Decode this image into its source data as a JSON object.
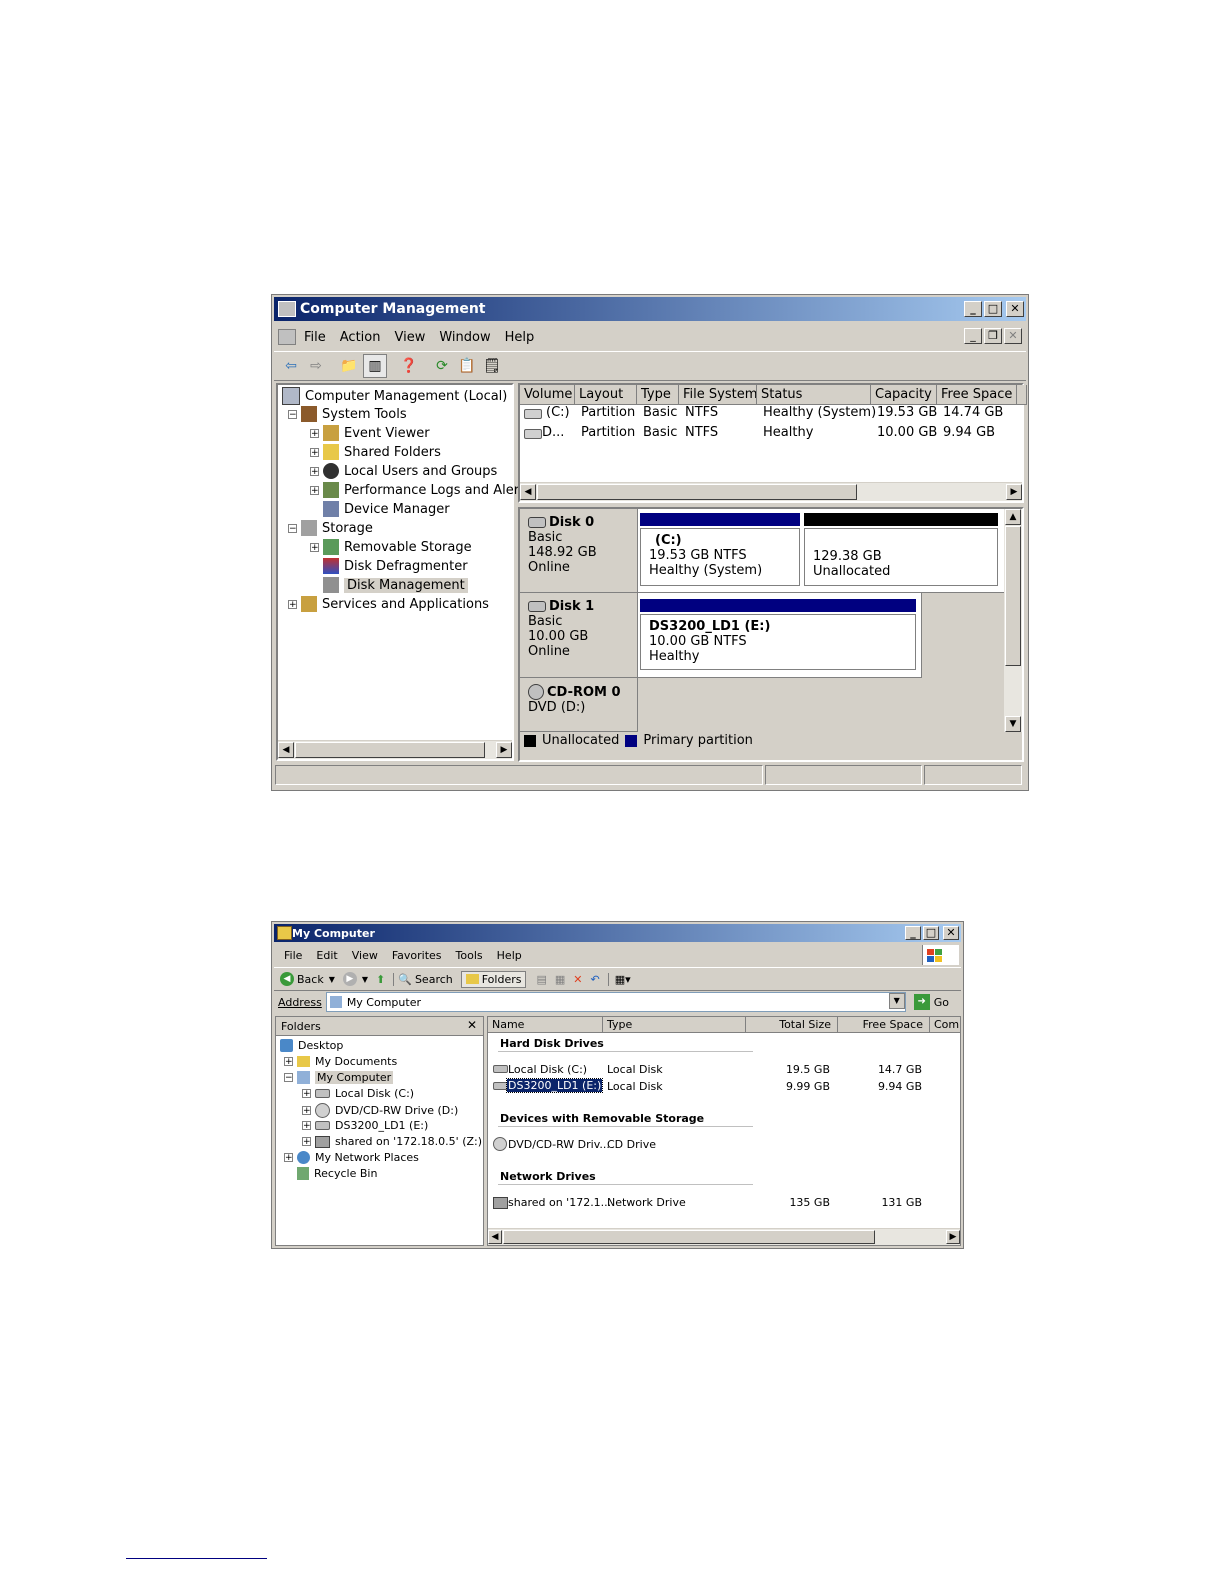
{
  "cm": {
    "title": "Computer Management",
    "menu": [
      "File",
      "Action",
      "View",
      "Window",
      "Help"
    ],
    "tree": [
      {
        "label": "Computer Management (Local)",
        "icon": "computer-icon"
      },
      {
        "label": "System Tools",
        "icon": "tools-icon"
      },
      {
        "label": "Event Viewer",
        "icon": "event-viewer-icon"
      },
      {
        "label": "Shared Folders",
        "icon": "folder-icon"
      },
      {
        "label": "Local Users and Groups",
        "icon": "users-icon"
      },
      {
        "label": "Performance Logs and Alerts",
        "icon": "performance-icon"
      },
      {
        "label": "Device Manager",
        "icon": "device-manager-icon"
      },
      {
        "label": "Storage",
        "icon": "storage-icon"
      },
      {
        "label": "Removable Storage",
        "icon": "removable-storage-icon"
      },
      {
        "label": "Disk Defragmenter",
        "icon": "defrag-icon"
      },
      {
        "label": "Disk Management",
        "icon": "disk-management-icon"
      },
      {
        "label": "Services and Applications",
        "icon": "services-icon"
      }
    ],
    "columns": [
      "Volume",
      "Layout",
      "Type",
      "File System",
      "Status",
      "Capacity",
      "Free Space"
    ],
    "rows": [
      [
        "(C:)",
        "Partition",
        "Basic",
        "NTFS",
        "Healthy (System)",
        "19.53 GB",
        "14.74 GB"
      ],
      [
        "D...",
        "Partition",
        "Basic",
        "NTFS",
        "Healthy",
        "10.00 GB",
        "9.94 GB"
      ]
    ],
    "disks": [
      {
        "name": "Disk 0",
        "type": "Basic",
        "size": "148.92 GB",
        "state": "Online"
      },
      {
        "name": "Disk 1",
        "type": "Basic",
        "size": "10.00 GB",
        "state": "Online"
      },
      {
        "name": "CD-ROM 0",
        "type": "DVD (D:)"
      }
    ],
    "partitions": {
      "c": {
        "name": "(C:)",
        "size": "19.53 GB NTFS",
        "status": "Healthy (System)"
      },
      "unalloc": {
        "size": "129.38 GB",
        "status": "Unallocated"
      },
      "e": {
        "name": "DS3200_LD1  (E:)",
        "size": "10.00 GB NTFS",
        "status": "Healthy"
      }
    },
    "legend": {
      "unallocated": "Unallocated",
      "primary": "Primary partition"
    },
    "colors": {
      "primary": "#000080",
      "unallocated": "#000000"
    }
  },
  "mc": {
    "title": "My Computer",
    "menu": [
      "File",
      "Edit",
      "View",
      "Favorites",
      "Tools",
      "Help"
    ],
    "toolbar": {
      "back": "Back",
      "search": "Search",
      "folders": "Folders"
    },
    "address_label": "Address",
    "address_value": "My Computer",
    "go": "Go",
    "folders_title": "Folders",
    "tree": [
      {
        "label": "Desktop",
        "icon": "desktop-icon"
      },
      {
        "label": "My Documents",
        "icon": "my-documents-icon"
      },
      {
        "label": "My Computer",
        "icon": "my-computer-icon"
      },
      {
        "label": "Local Disk (C:)",
        "icon": "hard-disk-icon"
      },
      {
        "label": "DVD/CD-RW Drive (D:)",
        "icon": "cd-drive-icon"
      },
      {
        "label": "DS3200_LD1 (E:)",
        "icon": "hard-disk-icon"
      },
      {
        "label": "shared on '172.18.0.5' (Z:)",
        "icon": "network-drive-icon"
      },
      {
        "label": "My Network Places",
        "icon": "network-places-icon"
      },
      {
        "label": "Recycle Bin",
        "icon": "recycle-bin-icon"
      }
    ],
    "columns": [
      "Name",
      "Type",
      "Total Size",
      "Free Space",
      "Comm"
    ],
    "groups": {
      "hdd": "Hard Disk Drives",
      "removable": "Devices with Removable Storage",
      "network": "Network Drives"
    },
    "items": {
      "c": {
        "name": "Local Disk (C:)",
        "type": "Local Disk",
        "total": "19.5 GB",
        "free": "14.7 GB"
      },
      "e": {
        "name": "DS3200_LD1 (E:)",
        "type": "Local Disk",
        "total": "9.99 GB",
        "free": "9.94 GB"
      },
      "d": {
        "name": "DVD/CD-RW Driv...",
        "type": "CD Drive"
      },
      "z": {
        "name": "shared on '172.1...",
        "type": "Network Drive",
        "total": "135 GB",
        "free": "131 GB"
      }
    }
  }
}
